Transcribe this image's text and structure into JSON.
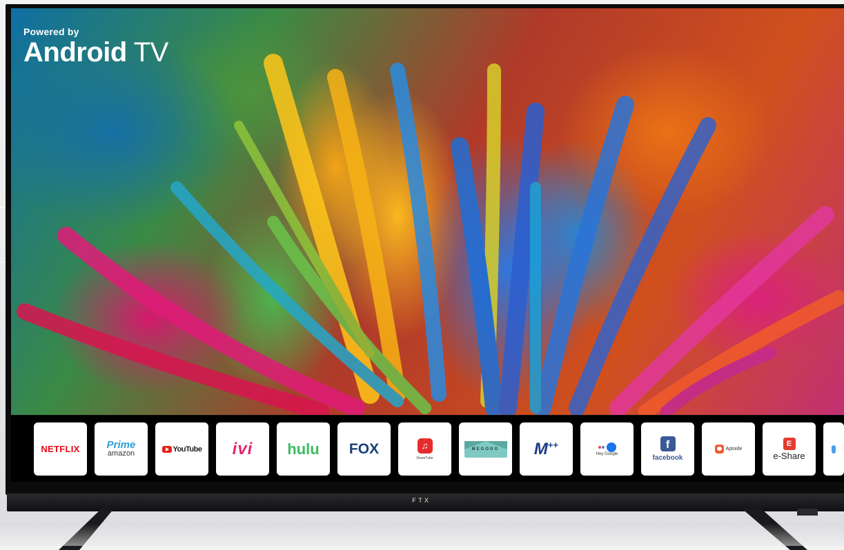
{
  "branding": {
    "powered_by": "Powered by",
    "os_name_bold": "Android",
    "os_name_light": "TV"
  },
  "tv_brand": "FTX",
  "apps": [
    {
      "name": "netflix",
      "label": "NETFLIX"
    },
    {
      "name": "prime-video",
      "label_line1": "Prime",
      "label_line2": "amazon"
    },
    {
      "name": "youtube",
      "label": "YouTube"
    },
    {
      "name": "ivi",
      "label": "ivi"
    },
    {
      "name": "hulu",
      "label": "hulu"
    },
    {
      "name": "fox",
      "label": "FOX"
    },
    {
      "name": "downtube",
      "label": "DownTube"
    },
    {
      "name": "megogo",
      "label": "MEGOGO"
    },
    {
      "name": "m-plus-plus",
      "label": "M",
      "sup": "++"
    },
    {
      "name": "hey-google",
      "label": "Hey Google"
    },
    {
      "name": "facebook",
      "label": "facebook",
      "glyph": "f"
    },
    {
      "name": "aptoide",
      "label": "Aptoide"
    },
    {
      "name": "e-share",
      "label": "e-Share",
      "glyph": "E"
    }
  ],
  "colors": {
    "netflix": "#e50914",
    "prime": "#2d9cd6",
    "youtube": "#e62117",
    "ivi": "#e5266f",
    "hulu": "#3dbb61",
    "fox": "#1b3f78",
    "facebook": "#3b5998",
    "aptoide": "#f05a28",
    "google_dots": [
      "#ea4335",
      "#fbbc05",
      "#34a853",
      "#4285f4"
    ]
  }
}
